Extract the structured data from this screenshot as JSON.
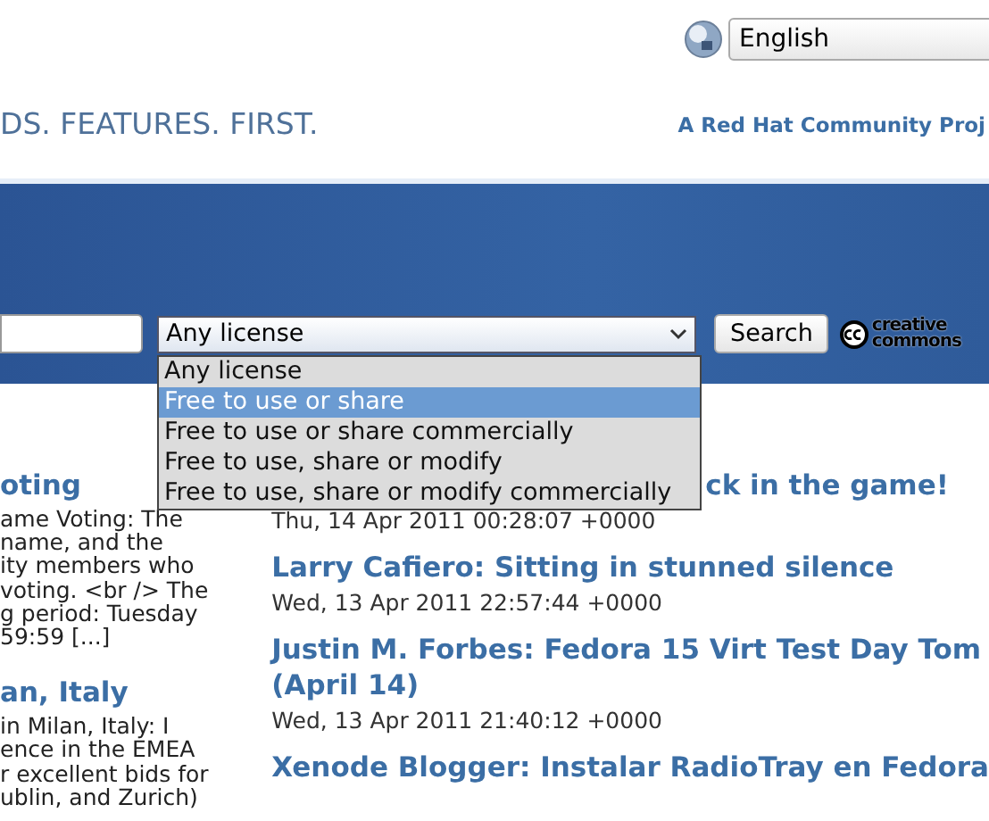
{
  "language_select": {
    "value": "English"
  },
  "tagline": "DS. FEATURES. FIRST.",
  "community_link": "A Red Hat Community Proj",
  "search": {
    "button": "Search",
    "logo_top": "creative",
    "logo_bottom": "commons"
  },
  "license_select": {
    "value": "Any license",
    "options": [
      {
        "label": "Any license",
        "highlighted": false
      },
      {
        "label": "Free to use or share",
        "highlighted": true
      },
      {
        "label": "Free to use or share commercially",
        "highlighted": false
      },
      {
        "label": "Free to use, share or modify",
        "highlighted": false
      },
      {
        "label": "Free to use, share or modify commercially",
        "highlighted": false
      }
    ]
  },
  "left_posts": [
    {
      "title": "oting",
      "lines": [
        "ame Voting: The",
        "name, and the",
        "ity members who",
        "voting. <br /> The",
        "g period: Tuesday",
        "59:59 [...]"
      ]
    },
    {
      "title": "an, Italy",
      "lines": [
        "in Milan, Italy: I",
        "ence in the EMEA",
        "r excellent bids for",
        "ublin, and Zurich)"
      ]
    }
  ],
  "right_posts": [
    {
      "title": [
        "ck in the game!"
      ],
      "date": "Thu, 14 Apr 2011 00:28:07 +0000"
    },
    {
      "title": [
        "Larry Cafiero: Sitting in stunned silence"
      ],
      "date": "Wed, 13 Apr 2011 22:57:44 +0000"
    },
    {
      "title": [
        "Justin M. Forbes: Fedora 15 Virt Test Day Tom",
        "(April 14)"
      ],
      "date": "Wed, 13 Apr 2011 21:40:12 +0000"
    },
    {
      "title": [
        "Xenode Blogger: Instalar RadioTray en Fedora"
      ]
    }
  ]
}
